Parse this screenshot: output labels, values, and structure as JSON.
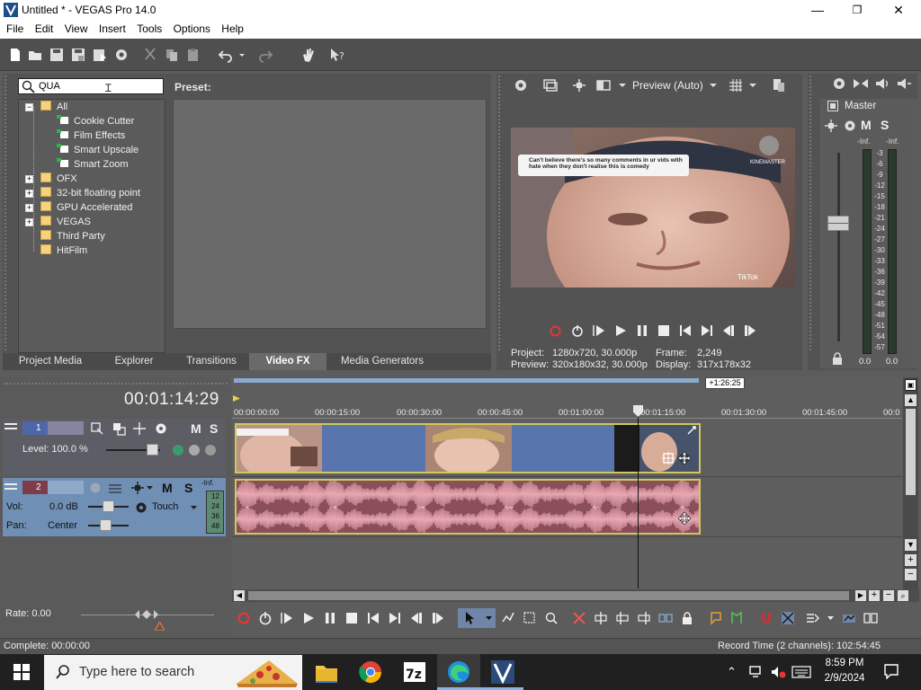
{
  "window": {
    "title": "Untitled * - VEGAS Pro 14.0",
    "controls": {
      "minimize": "—",
      "maximize": "❐",
      "close": "✕"
    }
  },
  "menu": [
    "File",
    "Edit",
    "View",
    "Insert",
    "Tools",
    "Options",
    "Help"
  ],
  "explorer": {
    "search_value": "QUA",
    "preset_label": "Preset:",
    "tree": [
      {
        "label": "All",
        "kind": "folder",
        "expanded": true
      },
      {
        "label": "Cookie Cutter",
        "kind": "plugin"
      },
      {
        "label": "Film Effects",
        "kind": "plugin"
      },
      {
        "label": "Smart Upscale",
        "kind": "plugin"
      },
      {
        "label": "Smart Zoom",
        "kind": "plugin"
      },
      {
        "label": "OFX",
        "kind": "folder"
      },
      {
        "label": "32-bit floating point",
        "kind": "folder"
      },
      {
        "label": "GPU Accelerated",
        "kind": "folder"
      },
      {
        "label": "VEGAS",
        "kind": "folder"
      },
      {
        "label": "Third Party",
        "kind": "folder"
      },
      {
        "label": "HitFilm",
        "kind": "folder"
      }
    ],
    "tabs": [
      "Project Media",
      "Explorer",
      "Transitions",
      "Video FX",
      "Media Generators"
    ],
    "active_tab": "Video FX"
  },
  "preview": {
    "mode": "Preview (Auto)",
    "overlay_caption": "Can't believe there's so many comments in ur vids with hate when they don't realise this is comedy",
    "watermark_top": "KINEMASTER",
    "watermark_bottom": "TikTok",
    "project_label": "Project:",
    "project_value": "1280x720, 30.000p",
    "preview_label": "Preview:",
    "preview_value": "320x180x32, 30.000p",
    "frame_label": "Frame:",
    "frame_value": "2,249",
    "display_label": "Display:",
    "display_value": "317x178x32"
  },
  "mixer": {
    "master_label": "Master",
    "m_label": "M",
    "s_label": "S",
    "inf_left": "-Inf.",
    "inf_right": "-Inf.",
    "scale": [
      "3",
      "6",
      "9",
      "12",
      "15",
      "18",
      "21",
      "24",
      "27",
      "30",
      "33",
      "36",
      "39",
      "42",
      "45",
      "48",
      "51",
      "54",
      "57"
    ],
    "value_left": "0.0",
    "value_right": "0.0"
  },
  "timeline": {
    "current_time": "00:01:14:29",
    "end_marker": "+1:26:25",
    "ruler": [
      "00:00:00:00",
      "00:00:15:00",
      "00:00:30:00",
      "00:00:45:00",
      "00:01:00:00",
      "00:01:15:00",
      "00:01:30:00",
      "00:01:45:00",
      "00:0"
    ],
    "track1": {
      "number": "1",
      "level_label": "Level: 100.0 %",
      "m": "M",
      "s": "S"
    },
    "track2": {
      "number": "2",
      "vol_label": "Vol:",
      "vol_value": "0.0 dB",
      "pan_label": "Pan:",
      "pan_value": "Center",
      "automation": "Touch",
      "m": "M",
      "s": "S",
      "meter_inf": "-Inf.",
      "meter_scale": [
        "12",
        "24",
        "36",
        "48"
      ]
    },
    "rate": "Rate: 0.00"
  },
  "status": {
    "complete": "Complete: 00:00:00",
    "record_time": "Record Time (2 channels): 102:54:45"
  },
  "taskbar": {
    "search_placeholder": "Type here to search",
    "time": "8:59 PM",
    "date": "2/9/2024"
  }
}
